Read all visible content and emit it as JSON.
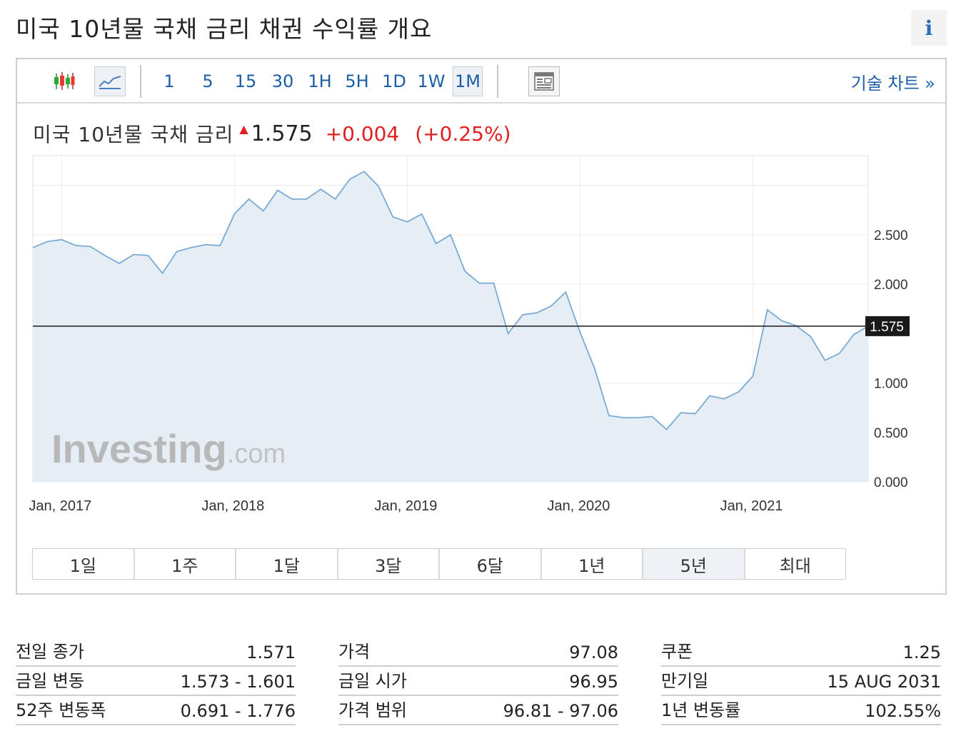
{
  "page_title": "미국 10년물 국채 금리  채권 수익률 개요",
  "info_label": "i",
  "toolbar": {
    "intervals": [
      "1",
      "5",
      "15",
      "30",
      "1H",
      "5H",
      "1D",
      "1W",
      "1M"
    ],
    "active_interval": "1M",
    "tech_chart_label": "기술 차트 »",
    "icons": [
      "candlestick-icon",
      "line-chart-icon",
      "table-icon"
    ]
  },
  "quote": {
    "name": "미국 10년물 국채 금리",
    "last": "1.575",
    "change": "+0.004",
    "change_pct": "(+0.25%)",
    "up_color": "#e02020"
  },
  "watermark": {
    "main": "Investing",
    "suffix": ".com"
  },
  "ranges": [
    "1일",
    "1주",
    "1달",
    "3달",
    "6달",
    "1년",
    "5년",
    "최대"
  ],
  "active_range": "5년",
  "chart_data": {
    "type": "area",
    "x_tick_labels": [
      "Jan, 2017",
      "Jan, 2018",
      "Jan, 2019",
      "Jan, 2020",
      "Jan, 2021"
    ],
    "y_tick_labels": [
      "0.000",
      "0.500",
      "1.000",
      "1.575",
      "2.000",
      "2.500"
    ],
    "ylim": [
      0,
      3.3
    ],
    "current_value": 1.575,
    "current_label": "1.575",
    "x_start": "2016-11",
    "interval": "monthly",
    "values": [
      2.37,
      2.43,
      2.45,
      2.39,
      2.38,
      2.29,
      2.21,
      2.3,
      2.29,
      2.11,
      2.33,
      2.37,
      2.4,
      2.39,
      2.71,
      2.86,
      2.74,
      2.95,
      2.86,
      2.86,
      2.96,
      2.86,
      3.06,
      3.14,
      2.99,
      2.68,
      2.63,
      2.71,
      2.41,
      2.5,
      2.13,
      2.01,
      2.01,
      1.5,
      1.69,
      1.71,
      1.78,
      1.92,
      1.51,
      1.15,
      0.67,
      0.65,
      0.65,
      0.66,
      0.53,
      0.7,
      0.69,
      0.87,
      0.84,
      0.91,
      1.07,
      1.74,
      1.63,
      1.58,
      1.47,
      1.23,
      1.3,
      1.49,
      1.575
    ],
    "grid": true,
    "line_color": "#7aaad4",
    "fill_color": "#e6eef5"
  },
  "stats": [
    [
      {
        "label": "전일 종가",
        "value": "1.571"
      },
      {
        "label": "금일 변동",
        "value": "1.573 - 1.601"
      },
      {
        "label": "52주 변동폭",
        "value": "0.691 - 1.776"
      }
    ],
    [
      {
        "label": "가격",
        "value": "97.08"
      },
      {
        "label": "금일 시가",
        "value": "96.95"
      },
      {
        "label": "가격 범위",
        "value": "96.81 - 97.06"
      }
    ],
    [
      {
        "label": "쿠폰",
        "value": "1.25"
      },
      {
        "label": "만기일",
        "value": "15 AUG 2031"
      },
      {
        "label": "1년 변동률",
        "value": "102.55%"
      }
    ]
  ]
}
